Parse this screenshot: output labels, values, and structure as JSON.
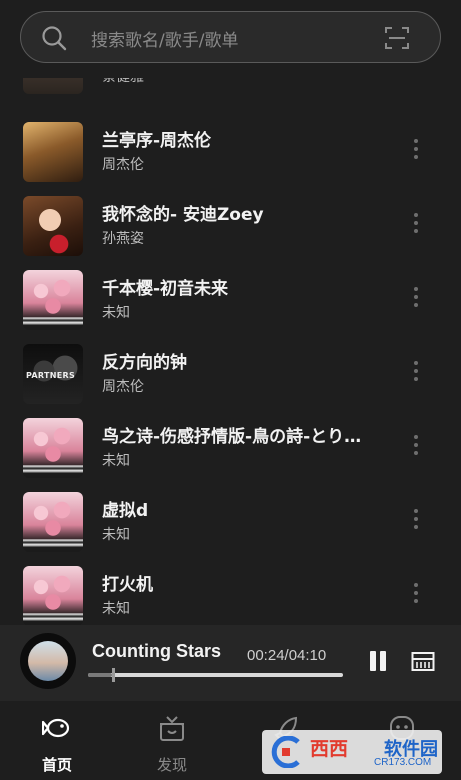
{
  "search": {
    "placeholder": "搜索歌名/歌手/歌单",
    "icon": "search-icon",
    "scan_icon": "scan-icon"
  },
  "songs": [
    {
      "title": "",
      "artist": "蔡健雅",
      "cover": "cov-top"
    },
    {
      "title": "兰亭序-周杰伦",
      "artist": "周杰伦",
      "cover": "cov-jay1"
    },
    {
      "title": "我怀念的- 安迪Zoey",
      "artist": "孙燕姿",
      "cover": "cov-girl"
    },
    {
      "title": "千本樱-初音未来",
      "artist": "未知",
      "cover": "cov-pink"
    },
    {
      "title": "反方向的钟",
      "artist": "周杰伦",
      "cover": "cov-part",
      "cover_text": "PARTNERS"
    },
    {
      "title": "鸟之诗-伤感抒情版-鳥の詩-とりのうた",
      "artist": "未知",
      "cover": "cov-pink"
    },
    {
      "title": "虚拟d",
      "artist": "未知",
      "cover": "cov-pink"
    },
    {
      "title": "打火机",
      "artist": "未知",
      "cover": "cov-pink"
    }
  ],
  "player": {
    "title": "Counting Stars",
    "time": "00:24/04:10",
    "progress": 0.096,
    "pause_icon": "pause-icon",
    "playlist_icon": "playlist-icon"
  },
  "tabs": [
    {
      "label": "首页",
      "icon": "fish-icon",
      "active": true
    },
    {
      "label": "发现",
      "icon": "gift-box-icon",
      "active": false
    },
    {
      "label": "",
      "icon": "rocket-icon",
      "active": false
    },
    {
      "label": "",
      "icon": "face-icon",
      "active": false
    }
  ],
  "watermark": {
    "brand": "西西",
    "name": "软件园",
    "url": "CR173.COM"
  },
  "colors": {
    "background": "#1e1e1e",
    "player_bg": "#262626",
    "text": "#f2f2f2",
    "subtext": "#bdbdbd"
  }
}
